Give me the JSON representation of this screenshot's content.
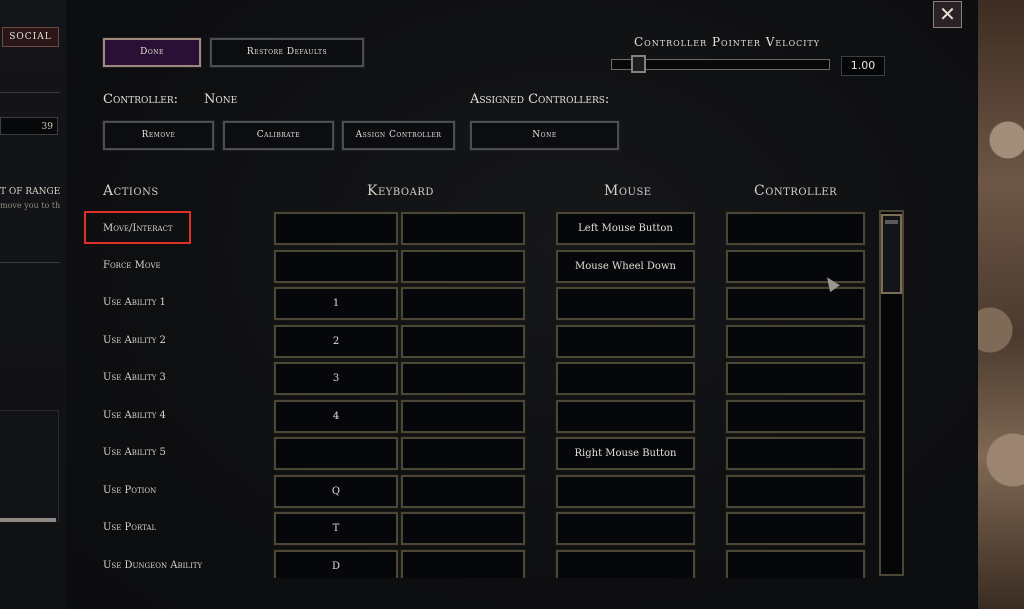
{
  "left_ui": {
    "social_tab": "SOCIAL",
    "field_value": "39",
    "label": "T OF RANGE",
    "sub_text": "move you to th"
  },
  "top": {
    "done_label": "Done",
    "restore_label": "Restore Defaults",
    "velocity_label": "Controller Pointer Velocity",
    "velocity_value": "1.00",
    "controller_label": "Controller:",
    "controller_value": "None",
    "assigned_label": "Assigned Controllers:",
    "remove_label": "Remove",
    "calibrate_label": "Calibrate",
    "assign_label": "Assign Controller",
    "assigned_value": "None"
  },
  "close_glyph": "✕",
  "columns": {
    "actions": "Actions",
    "keyboard": "Keyboard",
    "mouse": "Mouse",
    "controller": "Controller"
  },
  "rows": [
    {
      "action": "Move/Interact",
      "key1": "",
      "key2": "",
      "mouse": "Left Mouse Button",
      "controller": ""
    },
    {
      "action": "Force Move",
      "key1": "",
      "key2": "",
      "mouse": "Mouse Wheel Down",
      "controller": ""
    },
    {
      "action": "Use Ability 1",
      "key1": "1",
      "key2": "",
      "mouse": "",
      "controller": ""
    },
    {
      "action": "Use Ability 2",
      "key1": "2",
      "key2": "",
      "mouse": "",
      "controller": ""
    },
    {
      "action": "Use Ability 3",
      "key1": "3",
      "key2": "",
      "mouse": "",
      "controller": ""
    },
    {
      "action": "Use Ability 4",
      "key1": "4",
      "key2": "",
      "mouse": "",
      "controller": ""
    },
    {
      "action": "Use Ability 5",
      "key1": "",
      "key2": "",
      "mouse": "Right Mouse Button",
      "controller": ""
    },
    {
      "action": "Use Potion",
      "key1": "Q",
      "key2": "",
      "mouse": "",
      "controller": ""
    },
    {
      "action": "Use Portal",
      "key1": "T",
      "key2": "",
      "mouse": "",
      "controller": ""
    },
    {
      "action": "Use Dungeon Ability",
      "key1": "D",
      "key2": "",
      "mouse": "",
      "controller": ""
    }
  ],
  "highlight_color": "#e0302a"
}
